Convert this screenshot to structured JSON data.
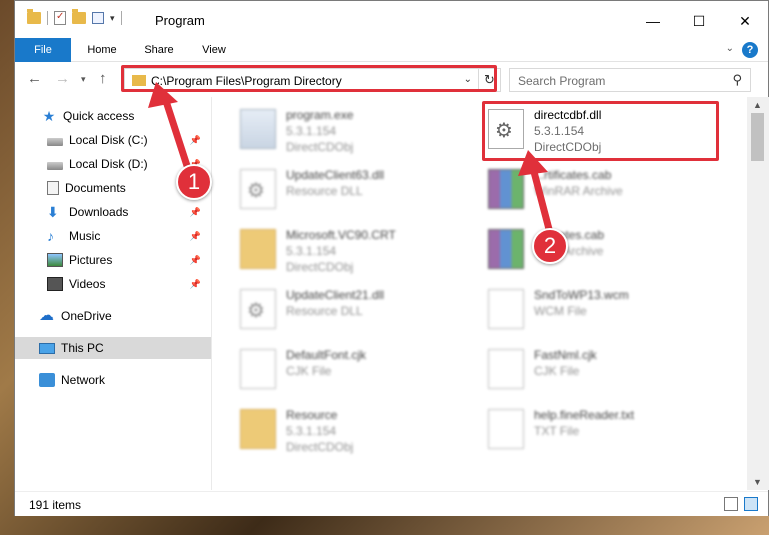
{
  "window": {
    "title": "Program"
  },
  "ribbon": {
    "tabs": [
      "File",
      "Home",
      "Share",
      "View"
    ],
    "help_label": "?"
  },
  "nav": {
    "address": "C:\\Program Files\\Program Directory",
    "search_placeholder": "Search Program"
  },
  "sidebar": {
    "items": [
      {
        "label": "Quick access",
        "icon": "star-icon",
        "pinned": false
      },
      {
        "label": "Local Disk (C:)",
        "icon": "disk-icon",
        "pinned": true
      },
      {
        "label": "Local Disk (D:)",
        "icon": "disk-icon",
        "pinned": true
      },
      {
        "label": "Documents",
        "icon": "documents-icon",
        "pinned": true
      },
      {
        "label": "Downloads",
        "icon": "download-icon",
        "pinned": true
      },
      {
        "label": "Music",
        "icon": "music-icon",
        "pinned": true
      },
      {
        "label": "Pictures",
        "icon": "pictures-icon",
        "pinned": true
      },
      {
        "label": "Videos",
        "icon": "videos-icon",
        "pinned": true
      },
      {
        "label": "OneDrive",
        "icon": "onedrive-icon",
        "pinned": false
      },
      {
        "label": "This PC",
        "icon": "this-pc-icon",
        "pinned": false,
        "selected": true
      },
      {
        "label": "Network",
        "icon": "network-icon",
        "pinned": false
      }
    ]
  },
  "files": [
    {
      "name": "program.exe",
      "line2": "5.3.1.154",
      "line3": "DirectCDObj",
      "type": "exe"
    },
    {
      "name": "directcdbf.dll",
      "line2": "5.3.1.154",
      "line3": "DirectCDObj",
      "type": "dll",
      "highlighted": true
    },
    {
      "name": "UpdateClient63.dll",
      "line2": "Resource DLL",
      "line3": "",
      "type": "dll"
    },
    {
      "name": "...rtificates.cab",
      "line2": "WinRAR Archive",
      "line3": "",
      "type": "rar"
    },
    {
      "name": "Microsoft.VC90.CRT",
      "line2": "5.3.1.154",
      "line3": "DirectCDObj",
      "type": "folder"
    },
    {
      "name": "...ificates.cab",
      "line2": "...AR Archive",
      "line3": "",
      "type": "rar"
    },
    {
      "name": "UpdateClient21.dll",
      "line2": "Resource DLL",
      "line3": "",
      "type": "dll"
    },
    {
      "name": "SndToWP13.wcm",
      "line2": "WCM File",
      "line3": "",
      "type": "file"
    },
    {
      "name": "DefaultFont.cjk",
      "line2": "CJK File",
      "line3": "",
      "type": "file"
    },
    {
      "name": "FastNml.cjk",
      "line2": "CJK File",
      "line3": "",
      "type": "file"
    },
    {
      "name": "Resource",
      "line2": "5.3.1.154",
      "line3": "DirectCDObj",
      "type": "folder"
    },
    {
      "name": "help.fineReader.txt",
      "line2": "TXT File",
      "line3": "",
      "type": "file"
    }
  ],
  "status": {
    "count": "191 items"
  },
  "annotations": {
    "badge1": "1",
    "badge2": "2",
    "color": "#e0303a"
  }
}
